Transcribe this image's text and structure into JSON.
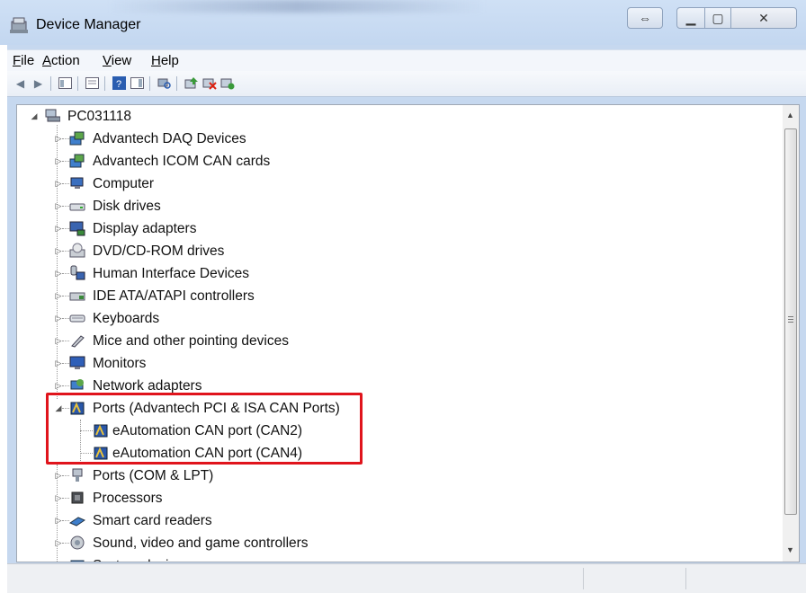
{
  "window": {
    "title": "Device Manager",
    "caption_buttons": [
      {
        "name": "snap-button",
        "glyph": "⇔"
      },
      {
        "name": "minimize-button",
        "glyph": "▁"
      },
      {
        "name": "maximize-button",
        "glyph": "▢"
      },
      {
        "name": "close-button",
        "glyph": "✕"
      }
    ]
  },
  "menu": {
    "file": {
      "key": "F",
      "rest": "ile"
    },
    "action": {
      "key": "A",
      "rest": "ction"
    },
    "view": {
      "key": "V",
      "rest": "iew"
    },
    "help": {
      "key": "H",
      "rest": "elp"
    }
  },
  "toolbar": [
    "back-icon",
    "forward-icon",
    "console-tree-icon",
    "properties-icon",
    "help-icon",
    "action-pane-icon",
    "scan-hardware-icon",
    "update-driver-icon",
    "uninstall-icon",
    "enable-icon"
  ],
  "tree": {
    "root": "PC031118",
    "items": [
      {
        "label": "Advantech DAQ Devices",
        "icon": "advantech-device-icon",
        "expander": "▷"
      },
      {
        "label": "Advantech ICOM CAN cards",
        "icon": "advantech-device-icon",
        "expander": "▷"
      },
      {
        "label": "Computer",
        "icon": "computer-icon",
        "expander": "▷"
      },
      {
        "label": "Disk drives",
        "icon": "disk-drive-icon",
        "expander": "▷"
      },
      {
        "label": "Display adapters",
        "icon": "display-adapter-icon",
        "expander": "▷"
      },
      {
        "label": "DVD/CD-ROM drives",
        "icon": "dvd-drive-icon",
        "expander": "▷"
      },
      {
        "label": "Human Interface Devices",
        "icon": "hid-icon",
        "expander": "▷"
      },
      {
        "label": "IDE ATA/ATAPI controllers",
        "icon": "ide-controller-icon",
        "expander": "▷"
      },
      {
        "label": "Keyboards",
        "icon": "keyboard-icon",
        "expander": "▷"
      },
      {
        "label": "Mice and other pointing devices",
        "icon": "mouse-icon",
        "expander": "▷"
      },
      {
        "label": "Monitors",
        "icon": "monitor-icon",
        "expander": "▷"
      },
      {
        "label": "Network adapters",
        "icon": "network-adapter-icon",
        "expander": "▷"
      },
      {
        "label": "Ports (Advantech PCI & ISA CAN Ports)",
        "icon": "can-port-icon",
        "expander": "◢"
      },
      {
        "label": "Ports (COM & LPT)",
        "icon": "com-port-icon",
        "expander": "▷"
      },
      {
        "label": "Processors",
        "icon": "processor-icon",
        "expander": "▷"
      },
      {
        "label": "Smart card readers",
        "icon": "smart-card-icon",
        "expander": "▷"
      },
      {
        "label": "Sound, video and game controllers",
        "icon": "sound-icon",
        "expander": "▷"
      },
      {
        "label": "System devices",
        "icon": "system-device-icon",
        "expander": "▷"
      }
    ],
    "can_children": [
      {
        "label": "eAutomation CAN port (CAN2)",
        "icon": "can-port-icon"
      },
      {
        "label": "eAutomation CAN port (CAN4)",
        "icon": "can-port-icon"
      }
    ]
  },
  "colors": {
    "highlight": "#e0141c",
    "titlebar": "#c3d7f0"
  }
}
